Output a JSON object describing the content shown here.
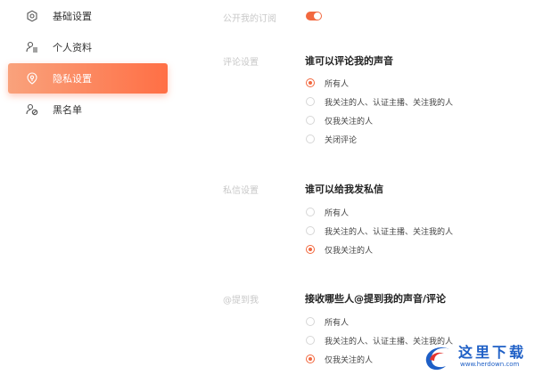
{
  "sidebar": {
    "items": [
      {
        "label": "基础设置",
        "icon": "gear-icon"
      },
      {
        "label": "个人资料",
        "icon": "user-list-icon"
      },
      {
        "label": "隐私设置",
        "icon": "shield-icon",
        "active": true
      },
      {
        "label": "黑名单",
        "icon": "user-block-icon"
      }
    ]
  },
  "subscription": {
    "label": "公开我的订阅",
    "toggle_on": true
  },
  "comment": {
    "label": "评论设置",
    "heading": "谁可以评论我的声音",
    "options": [
      {
        "label": "所有人",
        "checked": true
      },
      {
        "label": "我关注的人、认证主播、关注我的人",
        "checked": false
      },
      {
        "label": "仅我关注的人",
        "checked": false
      },
      {
        "label": "关闭评论",
        "checked": false
      }
    ]
  },
  "message": {
    "label": "私信设置",
    "heading": "谁可以给我发私信",
    "options": [
      {
        "label": "所有人",
        "checked": false
      },
      {
        "label": "我关注的人、认证主播、关注我的人",
        "checked": false
      },
      {
        "label": "仅我关注的人",
        "checked": true
      }
    ]
  },
  "mention": {
    "label": "@提到我",
    "heading": "接收哪些人@提到我的声音/评论",
    "options": [
      {
        "label": "所有人",
        "checked": false
      },
      {
        "label": "我关注的人、认证主播、关注我的人",
        "checked": false
      },
      {
        "label": "仅我关注的人",
        "checked": true
      }
    ]
  },
  "watermark": {
    "title": "这里下载",
    "url": "www.herdown.com"
  },
  "colors": {
    "accent": "#f2683f",
    "active_gradient_start": "#f9a27c",
    "active_gradient_end": "#ff6f45"
  }
}
